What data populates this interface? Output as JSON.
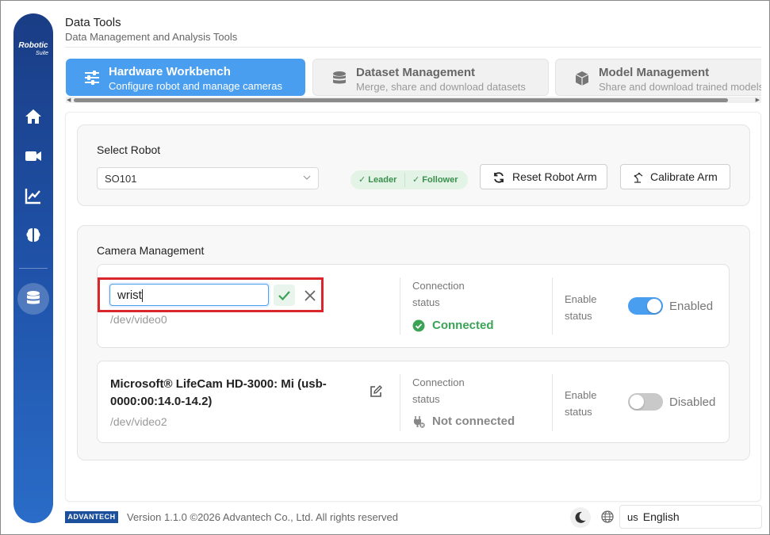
{
  "app": {
    "title": "Data Tools",
    "subtitle": "Data Management and Analysis Tools",
    "logo_line1": "Robotic",
    "logo_line2": "Suite"
  },
  "sidebar": {
    "items": [
      {
        "icon": "home-icon"
      },
      {
        "icon": "video-camera-icon"
      },
      {
        "icon": "chart-line-icon"
      },
      {
        "icon": "brain-icon"
      },
      {
        "icon": "database-icon",
        "active": true
      }
    ]
  },
  "tabs": [
    {
      "label": "Hardware Workbench",
      "sub": "Configure robot and manage cameras",
      "icon": "sliders-icon",
      "active": true
    },
    {
      "label": "Dataset Management",
      "sub": "Merge, share and download datasets",
      "icon": "database-icon"
    },
    {
      "label": "Model Management",
      "sub": "Share and download trained models",
      "icon": "cube-icon"
    }
  ],
  "robot": {
    "section_title": "Select Robot",
    "selected": "SO101",
    "leader_label": "Leader",
    "follower_label": "Follower",
    "reset_button": "Reset Robot Arm",
    "calibrate_button": "Calibrate Arm"
  },
  "cameras": {
    "section_title": "Camera Management",
    "items": [
      {
        "name_input": "wrist",
        "path": "/dev/video0",
        "connection_label": "Connection status",
        "connection_status": "Connected",
        "enable_label": "Enable status",
        "enable_value": "Enabled",
        "enabled": true
      },
      {
        "name": "Microsoft® LifeCam HD-3000: Mi (usb-0000:00:14.0-14.2)",
        "path": "/dev/video2",
        "connection_label": "Connection status",
        "connection_status": "Not connected",
        "enable_label": "Enable status",
        "enable_value": "Disabled",
        "enabled": false
      }
    ]
  },
  "colors": {
    "accent": "#4a9ef0",
    "success": "#3aa356",
    "sidebar": "#1f52a8",
    "highlight": "#d9262a"
  },
  "footer": {
    "brand": "ADVANTECH",
    "version": "Version 1.1.0 ©2026 Advantech Co., Ltd. All rights reserved",
    "language_code": "us",
    "language": "English"
  }
}
